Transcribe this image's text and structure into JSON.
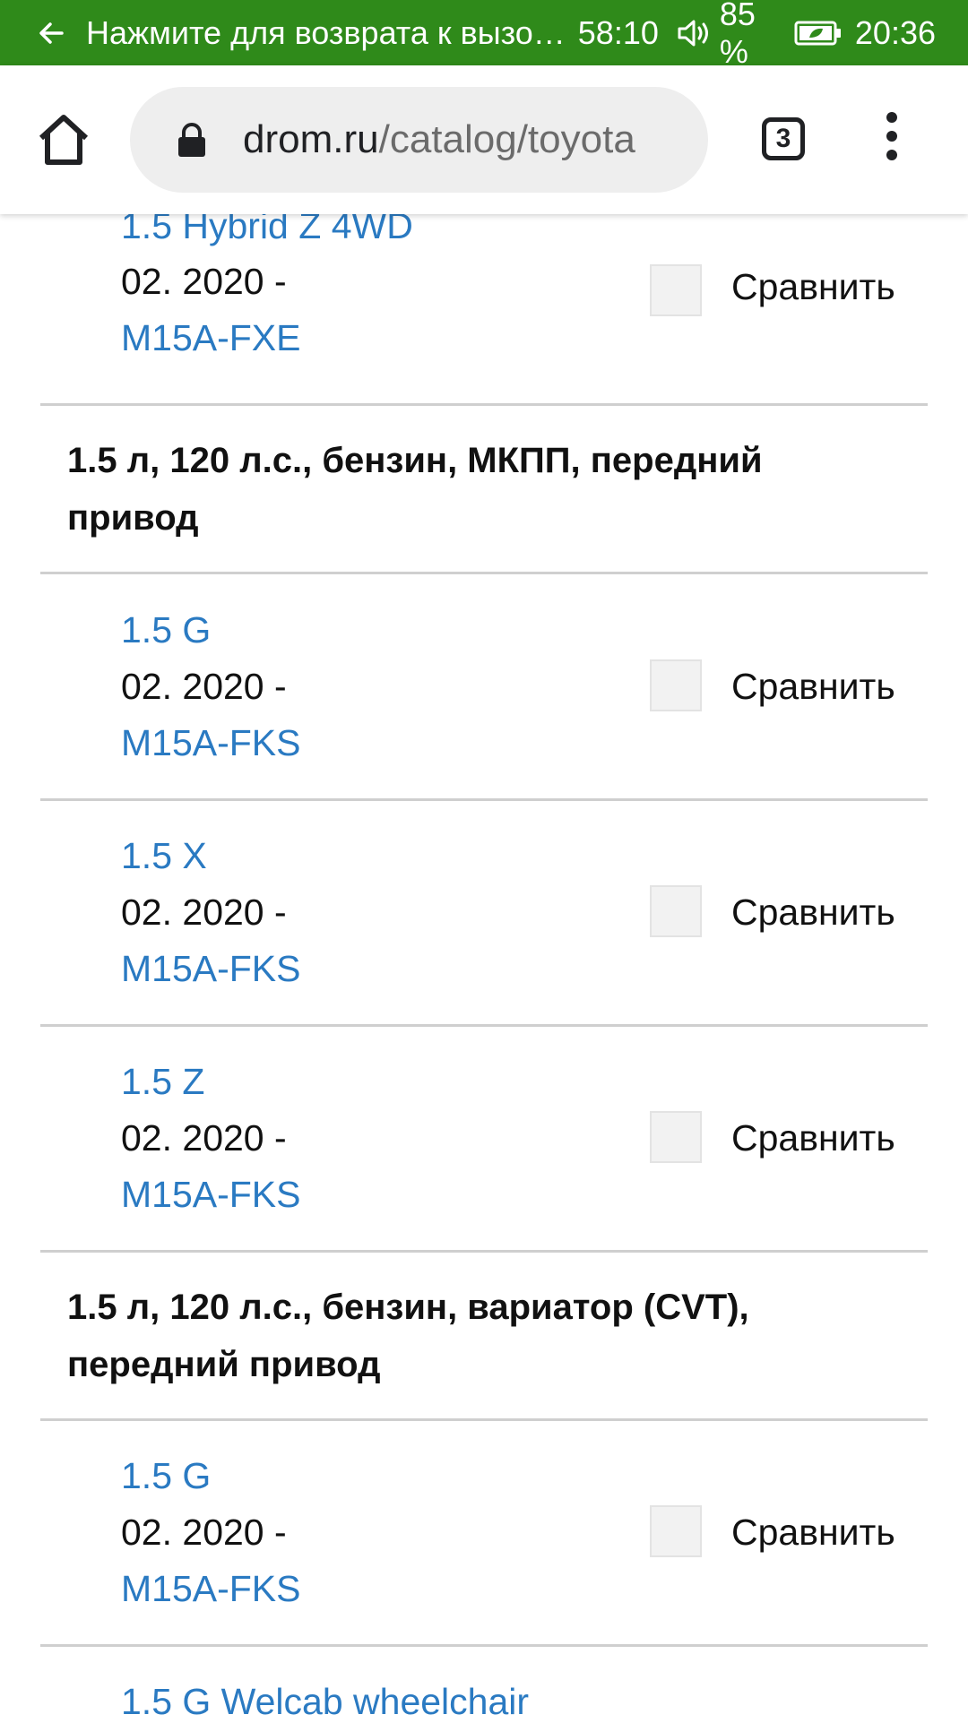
{
  "status_bar": {
    "return_text": "Нажмите для возврата к вызо…",
    "timer": "58:10",
    "battery_pct": "85 %",
    "clock": "20:36",
    "bg_color": "#2f8a1a"
  },
  "browser": {
    "url_host": "drom.ru",
    "url_path": "/catalog/toyota",
    "tab_count": "3"
  },
  "compare_label": "Сравнить",
  "items_top": {
    "name": "1.5 Hybrid Z 4WD",
    "date": "02. 2020  -",
    "engine": "M15A-FXE"
  },
  "groups": [
    {
      "heading": "1.5 л, 120 л.с., бензин, МКПП, передний привод",
      "items": [
        {
          "name": "1.5 G",
          "date": "02. 2020  -",
          "engine": "M15A-FKS"
        },
        {
          "name": "1.5 X",
          "date": "02. 2020  -",
          "engine": "M15A-FKS"
        },
        {
          "name": "1.5 Z",
          "date": "02. 2020  -",
          "engine": "M15A-FKS"
        }
      ]
    },
    {
      "heading": "1.5 л, 120 л.с., бензин, вариатор (CVT), передний привод",
      "items": [
        {
          "name": "1.5 G",
          "date": "02. 2020  -",
          "engine": "M15A-FKS"
        },
        {
          "name": "1.5 G Welcab wheelchair"
        }
      ]
    }
  ],
  "colors": {
    "link": "#2a7ac2",
    "divider": "#cfcfcf"
  }
}
